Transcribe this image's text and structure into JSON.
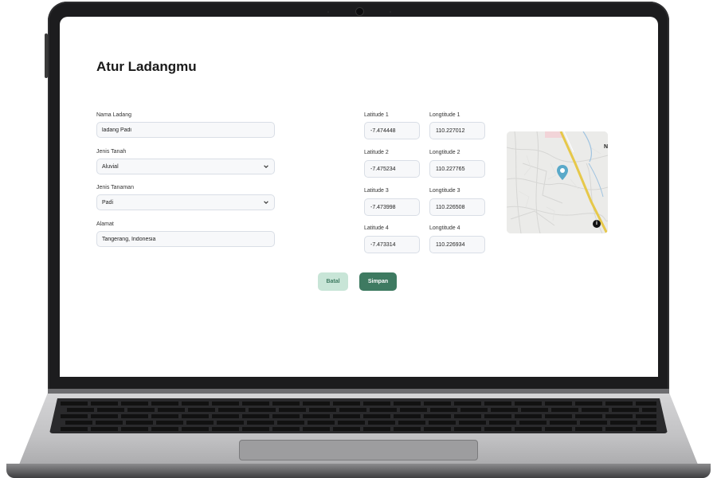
{
  "page": {
    "title": "Atur Ladangmu"
  },
  "form": {
    "name": {
      "label": "Nama Ladang",
      "value": "ladang Padi"
    },
    "soil": {
      "label": "Jenis Tanah",
      "value": "Aluvial"
    },
    "crop": {
      "label": "Jenis Tanaman",
      "value": "Padi"
    },
    "address": {
      "label": "Alamat",
      "value": "Tangerang, Indonesia"
    }
  },
  "coordinates": [
    {
      "lat_label": "Latitude 1",
      "lat": "-7.474448",
      "lng_label": "Longtitude 1",
      "lng": "110.227012"
    },
    {
      "lat_label": "Latitude 2",
      "lat": "-7.475234",
      "lng_label": "Longtitude 2",
      "lng": "110.227765"
    },
    {
      "lat_label": "Latitude 3",
      "lat": "-7.473998",
      "lng_label": "Longtitude 3",
      "lng": "110.226508"
    },
    {
      "lat_label": "Latitude 4",
      "lat": "-7.473314",
      "lng_label": "Longtitude 4",
      "lng": "110.226934"
    }
  ],
  "map": {
    "edge_label": "N",
    "marker_color": "#5aa9c9",
    "road_color": "#e6c84a"
  },
  "actions": {
    "cancel_label": "Batal",
    "save_label": "Simpan"
  },
  "colors": {
    "primary": "#3e7a61",
    "secondary": "#c8e5d7"
  }
}
